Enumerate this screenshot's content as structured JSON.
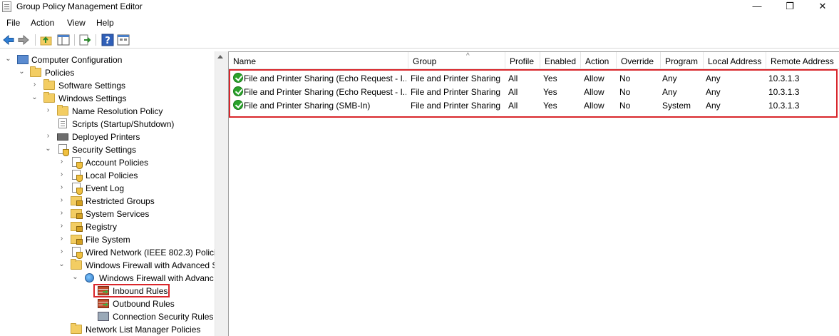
{
  "window": {
    "title": "Group Policy Management Editor",
    "controls": [
      "—",
      "❐",
      "✕"
    ]
  },
  "menu": [
    "File",
    "Action",
    "View",
    "Help"
  ],
  "tree": [
    {
      "label": "Computer Configuration",
      "expanded": true,
      "icon": "monitor-icon"
    },
    {
      "label": "Policies",
      "expanded": true,
      "icon": "folder-icon"
    },
    {
      "label": "Software Settings",
      "expanded": false,
      "icon": "folder-icon"
    },
    {
      "label": "Windows Settings",
      "expanded": true,
      "icon": "folder-icon"
    },
    {
      "label": "Name Resolution Policy",
      "expanded": false,
      "icon": "folder-icon"
    },
    {
      "label": "Scripts (Startup/Shutdown)",
      "icon": "script-doc-icon"
    },
    {
      "label": "Deployed Printers",
      "expanded": false,
      "icon": "printer-icon"
    },
    {
      "label": "Security Settings",
      "expanded": true,
      "icon": "security-doc-icon"
    },
    {
      "label": "Account Policies",
      "expanded": false,
      "icon": "policy-doc-icon"
    },
    {
      "label": "Local Policies",
      "expanded": false,
      "icon": "policy-doc-icon"
    },
    {
      "label": "Event Log",
      "expanded": false,
      "icon": "policy-doc-icon"
    },
    {
      "label": "Restricted Groups",
      "expanded": false,
      "icon": "locked-folder-icon"
    },
    {
      "label": "System Services",
      "expanded": false,
      "icon": "locked-folder-icon"
    },
    {
      "label": "Registry",
      "expanded": false,
      "icon": "locked-folder-icon"
    },
    {
      "label": "File System",
      "expanded": false,
      "icon": "locked-folder-icon"
    },
    {
      "label": "Wired Network (IEEE 802.3) Policie",
      "expanded": false,
      "icon": "policy-doc-icon"
    },
    {
      "label": "Windows Firewall with Advanced S",
      "expanded": true,
      "icon": "folder-icon"
    },
    {
      "label": "Windows Firewall with Advanc",
      "expanded": true,
      "icon": "firewall-globe-icon"
    },
    {
      "label": "Inbound Rules",
      "icon": "inbound-rules-icon",
      "selected": true
    },
    {
      "label": "Outbound Rules",
      "icon": "outbound-rules-icon"
    },
    {
      "label": "Connection Security Rules",
      "icon": "connection-security-icon"
    },
    {
      "label": "Network List Manager Policies",
      "icon": "folder-icon"
    }
  ],
  "list": {
    "columns": [
      "Name",
      "Group",
      "Profile",
      "Enabled",
      "Action",
      "Override",
      "Program",
      "Local Address",
      "Remote Address"
    ],
    "rows": [
      [
        "File and Printer Sharing (Echo Request - I...",
        "File and Printer Sharing",
        "All",
        "Yes",
        "Allow",
        "No",
        "Any",
        "Any",
        "10.3.1.3"
      ],
      [
        "File and Printer Sharing (Echo Request - I...",
        "File and Printer Sharing",
        "All",
        "Yes",
        "Allow",
        "No",
        "Any",
        "Any",
        "10.3.1.3"
      ],
      [
        "File and Printer Sharing (SMB-In)",
        "File and Printer Sharing",
        "All",
        "Yes",
        "Allow",
        "No",
        "System",
        "Any",
        "10.3.1.3"
      ]
    ]
  }
}
